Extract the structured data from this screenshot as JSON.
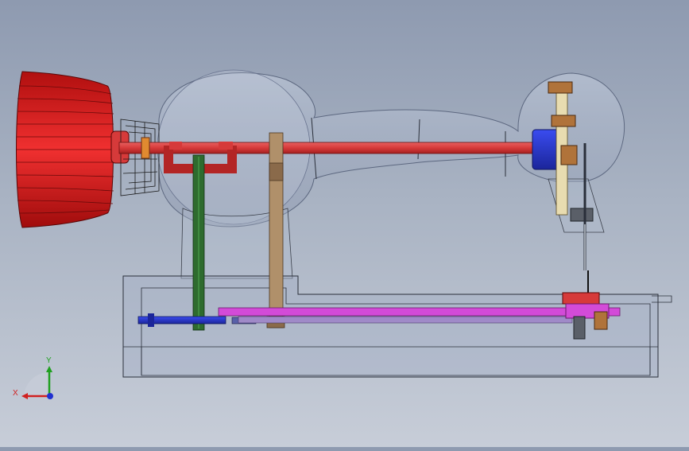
{
  "viewport": {
    "background_top": "#8e9ab0",
    "background_bottom": "#c7cdd8"
  },
  "model": {
    "handwheel_color": "#e01e1e",
    "main_shaft_color": "#d63a3a",
    "belt_green_color": "#2e6b2e",
    "belt_tan_color": "#b0906a",
    "blue_part_color": "#2a3ad8",
    "magenta_shaft_color": "#d34bd8",
    "housing_color": "#a4b0c6"
  },
  "triad": {
    "x_label": "X",
    "y_label": "Y",
    "x_color": "#d02020",
    "y_color": "#20a020",
    "z_color": "#2030d0"
  }
}
